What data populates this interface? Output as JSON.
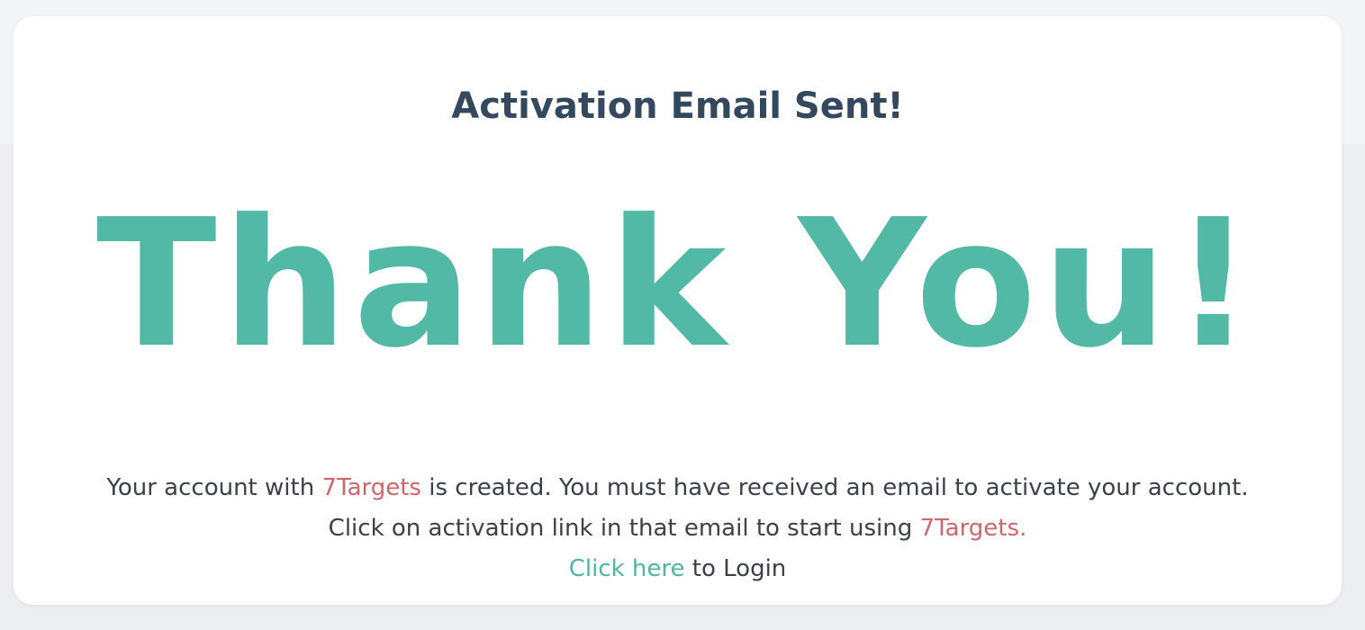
{
  "heading": "Activation Email Sent!",
  "hero_text": "Thank You!",
  "message": {
    "line1_before": "Your account with ",
    "line1_brand": "7Targets",
    "line1_after": " is created. You must have received an email to activate your account.",
    "line2_before": "Click on activation link in that email to start using ",
    "line2_brand": "7Targets.",
    "login_link": "Click here",
    "login_after": " to Login"
  },
  "colors": {
    "heading": "#34495e",
    "accent": "#52b9a6",
    "brand": "#d0666b",
    "text": "#3a414a"
  }
}
